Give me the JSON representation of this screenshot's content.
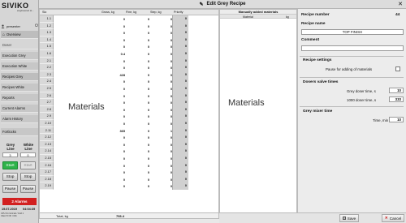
{
  "app": {
    "logo": "SIVIKO",
    "tagline": "engineered st..."
  },
  "user": {
    "name": "presenter"
  },
  "nav": [
    {
      "label": "Overview"
    },
    {
      "label": "Doser"
    },
    {
      "label": "Execution Grey"
    },
    {
      "label": "Execution White"
    },
    {
      "label": "Recipes Grey"
    },
    {
      "label": "Recipes White"
    },
    {
      "label": "Reports"
    },
    {
      "label": "Current Alarms"
    },
    {
      "label": "Alarm History"
    },
    {
      "label": "Fortlocks"
    }
  ],
  "controls": {
    "grey_line_label": "Grey Line",
    "white_line_label": "White Line",
    "grey_line_value": "3",
    "white_line_value": "0",
    "start_label": "Start",
    "stop_label": "Stop",
    "pause_label": "Pause"
  },
  "alarms": {
    "label": "2 Alarms"
  },
  "datetime": {
    "date": "19.07.2019",
    "time": "04:04:39"
  },
  "status": {
    "line1": "CPU On  Grid ab / Grid 1",
    "line2": "Client 5  OK / 001"
  },
  "window": {
    "title": "Edit Grey Recipe"
  },
  "grid": {
    "headers": {
      "slot": "Slo",
      "gross": "Gross, kg",
      "fine": "Fine, kg",
      "step": "Step, kg",
      "priority": "Priority"
    },
    "rows": [
      {
        "slot": "1.1",
        "gross": "0",
        "fine": "0",
        "step": "0",
        "priority": "0"
      },
      {
        "slot": "1.2",
        "gross": "0",
        "fine": "0",
        "step": "0",
        "priority": "0"
      },
      {
        "slot": "1.3",
        "gross": "0",
        "fine": "0",
        "step": "0",
        "priority": "0"
      },
      {
        "slot": "1.4",
        "gross": "0",
        "fine": "0",
        "step": "0",
        "priority": "0"
      },
      {
        "slot": "1.5",
        "gross": "0",
        "fine": "0",
        "step": "0",
        "priority": "0"
      },
      {
        "slot": "1.6",
        "gross": "0.4",
        "fine": "0",
        "step": "0",
        "priority": "0"
      },
      {
        "slot": "2.1",
        "gross": "0",
        "fine": "0",
        "step": "0",
        "priority": "0"
      },
      {
        "slot": "2.2",
        "gross": "0",
        "fine": "0",
        "step": "0",
        "priority": "0"
      },
      {
        "slot": "2.3",
        "gross": "428",
        "fine": "0",
        "step": "0",
        "priority": "0"
      },
      {
        "slot": "2.4",
        "gross": "0",
        "fine": "0",
        "step": "0",
        "priority": "0"
      },
      {
        "slot": "2.5",
        "gross": "0",
        "fine": "0",
        "step": "0",
        "priority": "0"
      },
      {
        "slot": "2.6",
        "gross": "0",
        "fine": "0",
        "step": "0",
        "priority": "0"
      },
      {
        "slot": "2.7",
        "gross": "0",
        "fine": "0",
        "step": "0",
        "priority": "0"
      },
      {
        "slot": "2.8",
        "gross": "0",
        "fine": "0",
        "step": "0",
        "priority": "0"
      },
      {
        "slot": "2.9",
        "gross": "0",
        "fine": "0",
        "step": "0",
        "priority": "0"
      },
      {
        "slot": "2.10",
        "gross": "0",
        "fine": "0",
        "step": "0",
        "priority": "0"
      },
      {
        "slot": "2.11",
        "gross": "365",
        "fine": "0",
        "step": "1",
        "priority": "0"
      },
      {
        "slot": "2.12",
        "gross": "0",
        "fine": "0",
        "step": "0",
        "priority": "0"
      },
      {
        "slot": "2.13",
        "gross": "0",
        "fine": "0",
        "step": "0",
        "priority": "0"
      },
      {
        "slot": "2.14",
        "gross": "0",
        "fine": "0",
        "step": "0",
        "priority": "0"
      },
      {
        "slot": "2.15",
        "gross": "0",
        "fine": "0",
        "step": "0",
        "priority": "0"
      },
      {
        "slot": "2.16",
        "gross": "0",
        "fine": "0",
        "step": "0",
        "priority": "0"
      },
      {
        "slot": "2.17",
        "gross": "0",
        "fine": "0",
        "step": "0",
        "priority": "0"
      },
      {
        "slot": "2.18",
        "gross": "0",
        "fine": "0",
        "step": "0",
        "priority": "0"
      },
      {
        "slot": "2.19",
        "gross": "0",
        "fine": "0",
        "step": "0",
        "priority": "0"
      }
    ],
    "watermark": "Materials",
    "total_label": "Total, kg",
    "total_value": "793.4"
  },
  "manual": {
    "title": "Manually added materials",
    "col_material": "Material",
    "col_kg": "kg",
    "watermark": "Materials"
  },
  "right": {
    "recipe_number_label": "Recipe number",
    "recipe_number": "44",
    "recipe_name_label": "Recipe name",
    "recipe_name": "TOP FINISH",
    "comment_label": "Comment",
    "comment": "",
    "settings_label": "Recipe settings",
    "pause_label": "Pause for adding of materials",
    "dosers_label": "Dosers valve times",
    "grey_doser_label": "Grey doser time, s",
    "grey_doser_value": "10",
    "doser1000_label": "1000 doser time, s",
    "doser1000_value": "333",
    "mixer_label": "Grey mixer time",
    "time_label": "Time, min",
    "time_value": "10"
  },
  "buttons": {
    "save": "Save",
    "cancel": "Cancel"
  },
  "colors": {
    "start": "#2fb34a",
    "alarm": "#d22020"
  }
}
